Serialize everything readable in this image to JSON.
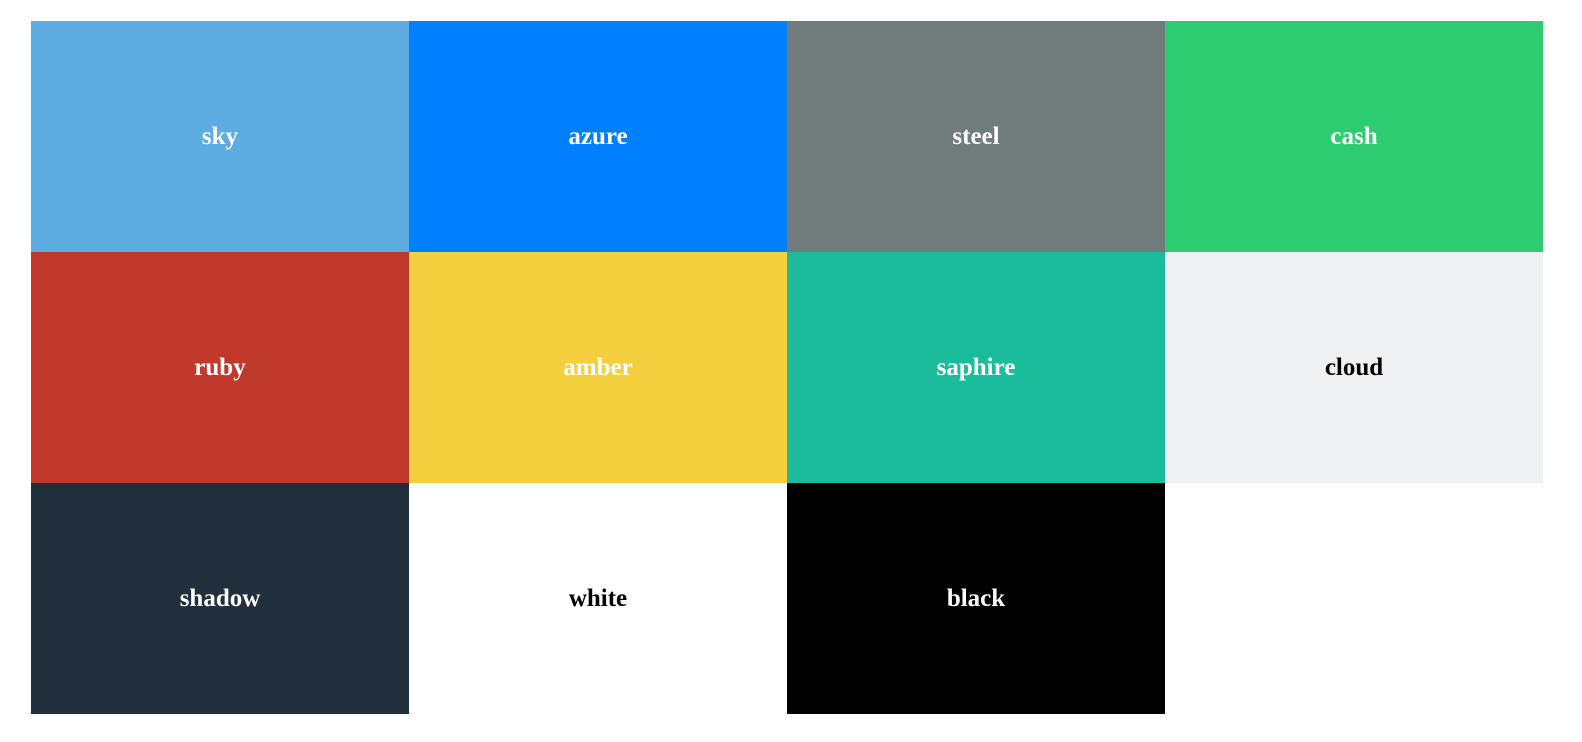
{
  "swatches": [
    {
      "label": "sky",
      "color": "#5DADE2",
      "text_color": "#FFFFFF"
    },
    {
      "label": "azure",
      "color": "#007FFF",
      "text_color": "#FFFFFF"
    },
    {
      "label": "steel",
      "color": "#707B7C",
      "text_color": "#FFFFFF"
    },
    {
      "label": "cash",
      "color": "#2ECC71",
      "text_color": "#FFFFFF"
    },
    {
      "label": "ruby",
      "color": "#C0392B",
      "text_color": "#FFFFFF"
    },
    {
      "label": "amber",
      "color": "#F4D03F",
      "text_color": "#FFFFFF"
    },
    {
      "label": "saphire",
      "color": "#1ABC9C",
      "text_color": "#FFFFFF"
    },
    {
      "label": "cloud",
      "color": "#F0F1F3",
      "text_color": "#000000"
    },
    {
      "label": "shadow",
      "color": "#212F3C",
      "text_color": "#FFFFFF"
    },
    {
      "label": "white",
      "color": "#FFFFFF",
      "text_color": "#000000"
    },
    {
      "label": "black",
      "color": "#000000",
      "text_color": "#FFFFFF"
    }
  ]
}
